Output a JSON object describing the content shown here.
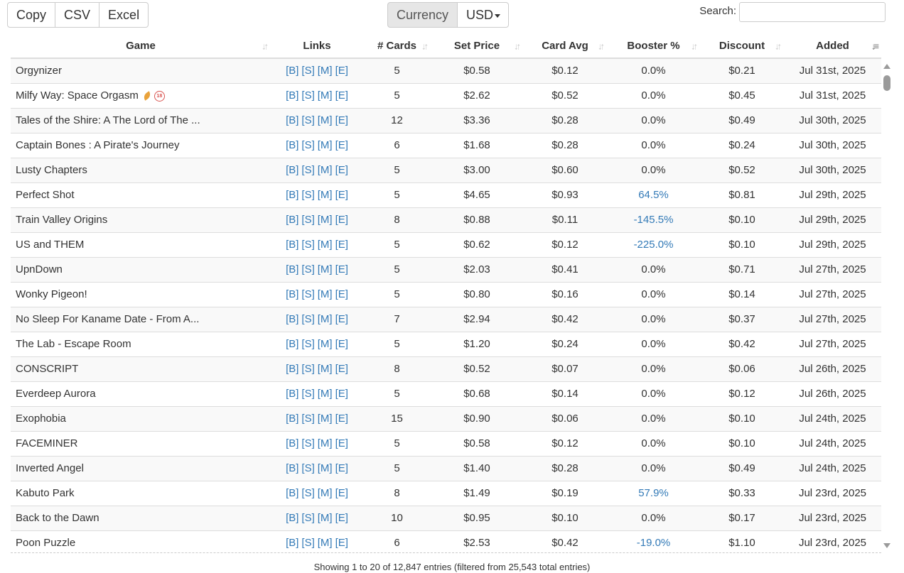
{
  "toolbar": {
    "export_buttons": [
      "Copy",
      "CSV",
      "Excel"
    ],
    "currency_label": "Currency",
    "currency_value": "USD",
    "search_label": "Search:",
    "search_value": ""
  },
  "table": {
    "columns": [
      "Game",
      "Links",
      "# Cards",
      "Set Price",
      "Card Avg",
      "Booster %",
      "Discount",
      "Added"
    ],
    "link_labels": [
      "[B]",
      "[S]",
      "[M]",
      "[E]"
    ],
    "rows": [
      {
        "game": "Orgynizer",
        "badges": [],
        "cards": "5",
        "set_price": "$0.58",
        "card_avg": "$0.12",
        "booster": "0.0%",
        "booster_link": false,
        "discount": "$0.21",
        "added": "Jul 31st, 2025"
      },
      {
        "game": "Milfy Way: Space Orgasm",
        "badges": [
          "leaf-icon",
          "adult-18-icon"
        ],
        "cards": "5",
        "set_price": "$2.62",
        "card_avg": "$0.52",
        "booster": "0.0%",
        "booster_link": false,
        "discount": "$0.45",
        "added": "Jul 31st, 2025"
      },
      {
        "game": "Tales of the Shire: A The Lord of The ...",
        "badges": [],
        "cards": "12",
        "set_price": "$3.36",
        "card_avg": "$0.28",
        "booster": "0.0%",
        "booster_link": false,
        "discount": "$0.49",
        "added": "Jul 30th, 2025"
      },
      {
        "game": "Captain Bones : A Pirate's Journey",
        "badges": [],
        "cards": "6",
        "set_price": "$1.68",
        "card_avg": "$0.28",
        "booster": "0.0%",
        "booster_link": false,
        "discount": "$0.24",
        "added": "Jul 30th, 2025"
      },
      {
        "game": "Lusty Chapters",
        "badges": [],
        "cards": "5",
        "set_price": "$3.00",
        "card_avg": "$0.60",
        "booster": "0.0%",
        "booster_link": false,
        "discount": "$0.52",
        "added": "Jul 30th, 2025"
      },
      {
        "game": "Perfect Shot",
        "badges": [],
        "cards": "5",
        "set_price": "$4.65",
        "card_avg": "$0.93",
        "booster": "64.5%",
        "booster_link": true,
        "discount": "$0.81",
        "added": "Jul 29th, 2025"
      },
      {
        "game": "Train Valley Origins",
        "badges": [],
        "cards": "8",
        "set_price": "$0.88",
        "card_avg": "$0.11",
        "booster": "-145.5%",
        "booster_link": true,
        "discount": "$0.10",
        "added": "Jul 29th, 2025"
      },
      {
        "game": "US and THEM",
        "badges": [],
        "cards": "5",
        "set_price": "$0.62",
        "card_avg": "$0.12",
        "booster": "-225.0%",
        "booster_link": true,
        "discount": "$0.10",
        "added": "Jul 29th, 2025"
      },
      {
        "game": "UpnDown",
        "badges": [],
        "cards": "5",
        "set_price": "$2.03",
        "card_avg": "$0.41",
        "booster": "0.0%",
        "booster_link": false,
        "discount": "$0.71",
        "added": "Jul 27th, 2025"
      },
      {
        "game": "Wonky Pigeon!",
        "badges": [],
        "cards": "5",
        "set_price": "$0.80",
        "card_avg": "$0.16",
        "booster": "0.0%",
        "booster_link": false,
        "discount": "$0.14",
        "added": "Jul 27th, 2025"
      },
      {
        "game": "No Sleep For Kaname Date - From A...",
        "badges": [],
        "cards": "7",
        "set_price": "$2.94",
        "card_avg": "$0.42",
        "booster": "0.0%",
        "booster_link": false,
        "discount": "$0.37",
        "added": "Jul 27th, 2025"
      },
      {
        "game": "The Lab - Escape Room",
        "badges": [],
        "cards": "5",
        "set_price": "$1.20",
        "card_avg": "$0.24",
        "booster": "0.0%",
        "booster_link": false,
        "discount": "$0.42",
        "added": "Jul 27th, 2025"
      },
      {
        "game": "CONSCRIPT",
        "badges": [],
        "cards": "8",
        "set_price": "$0.52",
        "card_avg": "$0.07",
        "booster": "0.0%",
        "booster_link": false,
        "discount": "$0.06",
        "added": "Jul 26th, 2025"
      },
      {
        "game": "Everdeep Aurora",
        "badges": [],
        "cards": "5",
        "set_price": "$0.68",
        "card_avg": "$0.14",
        "booster": "0.0%",
        "booster_link": false,
        "discount": "$0.12",
        "added": "Jul 26th, 2025"
      },
      {
        "game": "Exophobia",
        "badges": [],
        "cards": "15",
        "set_price": "$0.90",
        "card_avg": "$0.06",
        "booster": "0.0%",
        "booster_link": false,
        "discount": "$0.10",
        "added": "Jul 24th, 2025"
      },
      {
        "game": "FACEMINER",
        "badges": [],
        "cards": "5",
        "set_price": "$0.58",
        "card_avg": "$0.12",
        "booster": "0.0%",
        "booster_link": false,
        "discount": "$0.10",
        "added": "Jul 24th, 2025"
      },
      {
        "game": "Inverted Angel",
        "badges": [],
        "cards": "5",
        "set_price": "$1.40",
        "card_avg": "$0.28",
        "booster": "0.0%",
        "booster_link": false,
        "discount": "$0.49",
        "added": "Jul 24th, 2025"
      },
      {
        "game": "Kabuto Park",
        "badges": [],
        "cards": "8",
        "set_price": "$1.49",
        "card_avg": "$0.19",
        "booster": "57.9%",
        "booster_link": true,
        "discount": "$0.33",
        "added": "Jul 23rd, 2025"
      },
      {
        "game": "Back to the Dawn",
        "badges": [],
        "cards": "10",
        "set_price": "$0.95",
        "card_avg": "$0.10",
        "booster": "0.0%",
        "booster_link": false,
        "discount": "$0.17",
        "added": "Jul 23rd, 2025"
      },
      {
        "game": "Poon Puzzle",
        "badges": [],
        "cards": "6",
        "set_price": "$2.53",
        "card_avg": "$0.42",
        "booster": "-19.0%",
        "booster_link": true,
        "discount": "$1.10",
        "added": "Jul 23rd, 2025"
      }
    ]
  },
  "footer": {
    "info": "Showing 1 to 20 of 12,847 entries (filtered from 25,543 total entries)"
  },
  "colors": {
    "link": "#337ab7",
    "stripe": "#f9f9f9",
    "border": "#dddddd"
  }
}
